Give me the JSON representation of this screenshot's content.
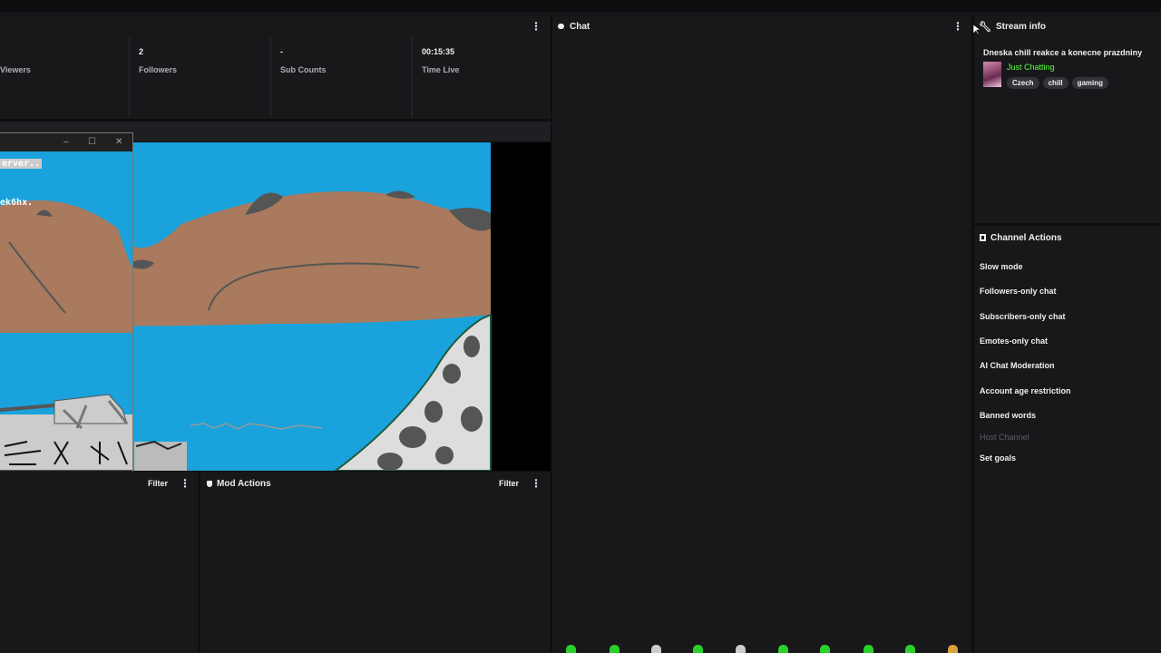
{
  "stats": [
    {
      "value": "",
      "label": "Viewers"
    },
    {
      "value": "2",
      "label": "Followers"
    },
    {
      "value": "-",
      "label": "Sub Counts"
    },
    {
      "value": "00:15:35",
      "label": "Time Live"
    }
  ],
  "chat": {
    "title": "Chat"
  },
  "stream_info": {
    "title": "Stream info",
    "stream_title": "Dneska chill reakce a konecne prazdniny",
    "category": "Just Chatting",
    "tags": [
      "Czech",
      "chill",
      "gaming"
    ]
  },
  "channel_actions": {
    "title": "Channel Actions",
    "items": [
      {
        "label": "Slow mode",
        "enabled": true
      },
      {
        "label": "Followers-only chat",
        "enabled": true
      },
      {
        "label": "Subscribers-only chat",
        "enabled": true
      },
      {
        "label": "Emotes-only chat",
        "enabled": true
      },
      {
        "label": "AI Chat Moderation",
        "enabled": true
      },
      {
        "label": "Account age restriction",
        "enabled": true
      },
      {
        "label": "Banned words",
        "enabled": true
      },
      {
        "label": "Host Channel",
        "enabled": false
      },
      {
        "label": "Set goals",
        "enabled": true
      }
    ]
  },
  "activity": {
    "filter_label": "Filter"
  },
  "mod_actions": {
    "title": "Mod Actions",
    "filter_label": "Filter"
  },
  "window_controls": {
    "minimize": "–",
    "maximize": "☐",
    "close": "✕"
  },
  "overlay": {
    "line1": "erver..",
    "line2": "ek6hx."
  },
  "colors": {
    "accent_category": "#5cff3c",
    "background": "#0e0e10",
    "panel": "#18181b",
    "sky": "#19a2dc",
    "hill": "#a97a5d"
  },
  "icons": [
    "chat-bubble-icon",
    "wrench-icon",
    "clipboard-icon",
    "mod-shield-icon",
    "kebab-menu-icon",
    "minimize-icon",
    "maximize-icon",
    "close-icon",
    "emote-icon"
  ]
}
